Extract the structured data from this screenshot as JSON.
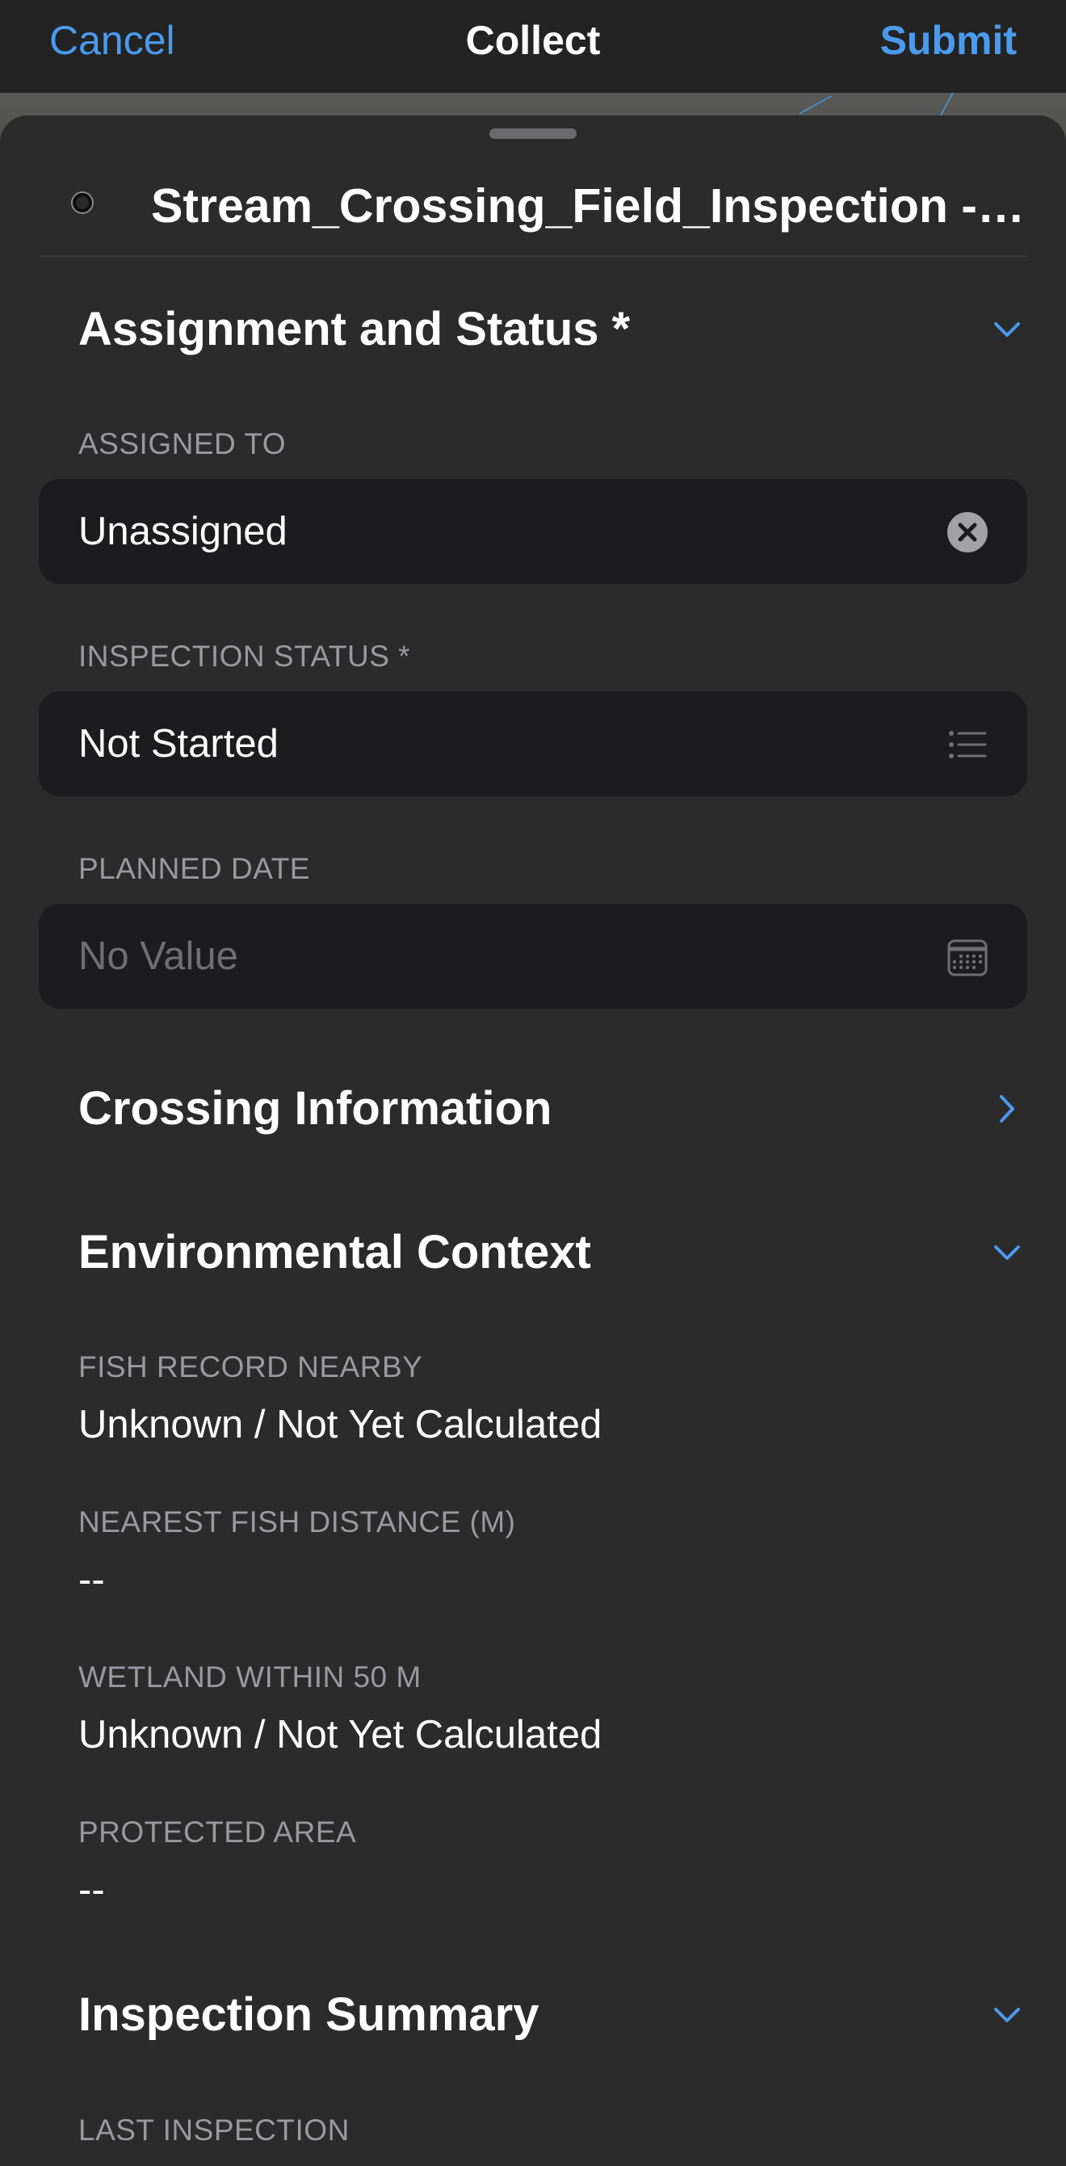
{
  "navbar": {
    "cancel_label": "Cancel",
    "title": "Collect",
    "submit_label": "Submit"
  },
  "sheet": {
    "title": "Stream_Crossing_Field_Inspection - S..."
  },
  "groups": {
    "assignment": {
      "title": "Assignment and Status *",
      "expanded": true,
      "fields": {
        "assigned_to": {
          "label": "ASSIGNED TO",
          "value": "Unassigned",
          "icon": "clear-icon"
        },
        "inspection_status": {
          "label": "INSPECTION STATUS *",
          "value": "Not Started",
          "icon": "list-icon"
        },
        "planned_date": {
          "label": "PLANNED DATE",
          "placeholder": "No Value",
          "icon": "calendar-icon"
        }
      }
    },
    "crossing": {
      "title": "Crossing Information",
      "expanded": false
    },
    "environmental": {
      "title": "Environmental Context",
      "expanded": true,
      "fields": {
        "fish_record": {
          "label": "FISH RECORD NEARBY",
          "value": "Unknown / Not Yet Calculated"
        },
        "fish_distance": {
          "label": "NEAREST FISH DISTANCE (M)",
          "value": "--"
        },
        "wetland": {
          "label": "WETLAND WITHIN 50 M",
          "value": "Unknown / Not Yet Calculated"
        },
        "protected_area": {
          "label": "PROTECTED AREA",
          "value": "--"
        }
      }
    },
    "summary": {
      "title": "Inspection Summary",
      "expanded": true,
      "fields": {
        "last_inspection": {
          "label": "LAST INSPECTION"
        }
      }
    }
  },
  "colors": {
    "accent": "#4a9bed",
    "sheet_background": "#2b2b2c",
    "field_background": "#1c1c1e",
    "label": "#9a9a9e"
  }
}
